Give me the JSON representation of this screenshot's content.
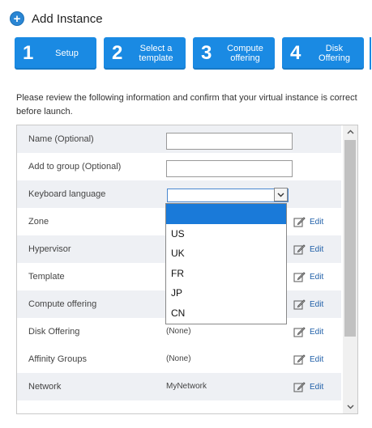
{
  "header": {
    "title": "Add Instance"
  },
  "steps": [
    {
      "num": "1",
      "label": "Setup"
    },
    {
      "num": "2",
      "label": "Select a template"
    },
    {
      "num": "3",
      "label": "Compute offering"
    },
    {
      "num": "4",
      "label": "Disk Offering"
    }
  ],
  "intro": "Please review the following information and confirm that your virtual instance is correct before launch.",
  "form": {
    "rows": [
      {
        "label": "Name (Optional)"
      },
      {
        "label": "Add to group (Optional)"
      },
      {
        "label": "Keyboard language"
      },
      {
        "label": "Zone",
        "edit": "Edit"
      },
      {
        "label": "Hypervisor",
        "edit": "Edit"
      },
      {
        "label": "Template",
        "edit": "Edit"
      },
      {
        "label": "Compute offering",
        "edit": "Edit"
      },
      {
        "label": "Disk Offering",
        "value": "(None)",
        "edit": "Edit"
      },
      {
        "label": "Affinity Groups",
        "value": "(None)",
        "edit": "Edit"
      },
      {
        "label": "Network",
        "value": "MyNetwork",
        "edit": "Edit"
      }
    ]
  },
  "keyboard_dropdown": {
    "selected": "",
    "options": [
      "",
      "US",
      "UK",
      "FR",
      "JP",
      "CN"
    ]
  },
  "colors": {
    "accent": "#1a8ae3",
    "selection": "#1a7ad9",
    "link": "#1f5fa8"
  }
}
